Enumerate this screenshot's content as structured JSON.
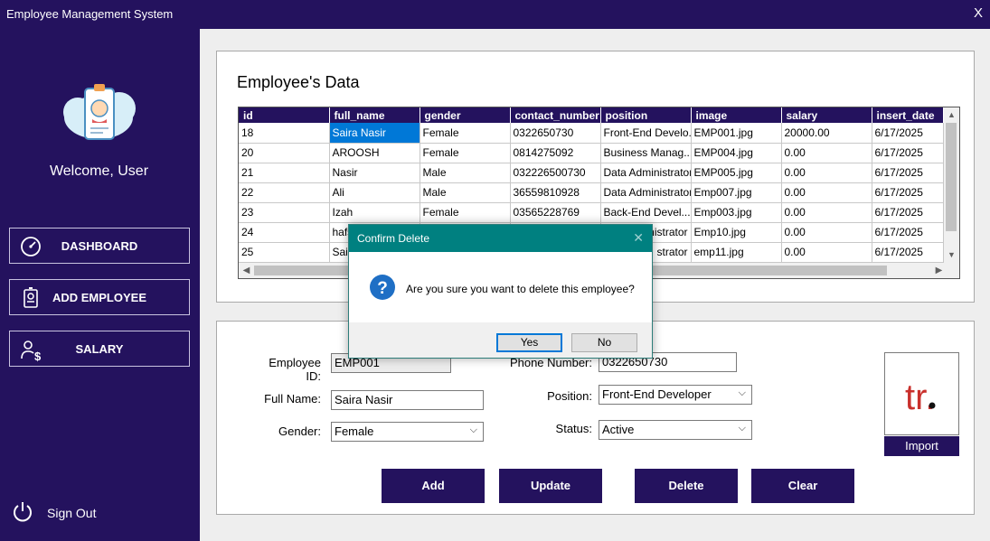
{
  "window": {
    "title": "Employee Management System",
    "close": "X"
  },
  "sidebar": {
    "welcome": "Welcome, User",
    "nav": {
      "dashboard": "DASHBOARD",
      "add_employee": "ADD EMPLOYEE",
      "salary": "SALARY"
    },
    "sign_out": "Sign Out"
  },
  "grid": {
    "title": "Employee's Data",
    "columns": [
      "id",
      "full_name",
      "gender",
      "contact_number",
      "position",
      "image",
      "salary",
      "insert_date"
    ],
    "rows": [
      [
        "18",
        "Saira Nasir",
        "Female",
        "0322650730",
        "Front-End Develo...",
        "EMP001.jpg",
        "20000.00",
        "6/17/2025"
      ],
      [
        "20",
        "AROOSH",
        "Female",
        "0814275092",
        "Business Manag...",
        "EMP004.jpg",
        "0.00",
        "6/17/2025"
      ],
      [
        "21",
        "Nasir",
        "Male",
        "032226500730",
        "Data Administrator",
        "EMP005.jpg",
        "0.00",
        "6/17/2025"
      ],
      [
        "22",
        "Ali",
        "Male",
        "36559810928",
        "Data Administrator",
        "Emp007.jpg",
        "0.00",
        "6/17/2025"
      ],
      [
        "23",
        "Izah",
        "Female",
        "03565228769",
        "Back-End Devel...",
        "Emp003.jpg",
        "0.00",
        "6/17/2025"
      ],
      [
        "24",
        "hafs",
        "",
        "",
        "dministrator",
        "Emp10.jpg",
        "0.00",
        "6/17/2025"
      ],
      [
        "25",
        "Sair",
        "",
        "",
        "strator",
        "emp11.jpg",
        "0.00",
        "6/17/2025"
      ]
    ]
  },
  "form": {
    "labels": {
      "employee_id": "Employee ID:",
      "full_name": "Full Name:",
      "gender": "Gender:",
      "phone": "Phone Number:",
      "position": "Position:",
      "status": "Status:"
    },
    "values": {
      "employee_id": "EMP001",
      "full_name": "Saira Nasir",
      "gender": "Female",
      "phone": "0322650730",
      "position": "Front-End Developer",
      "status": "Active"
    },
    "buttons": {
      "add": "Add",
      "update": "Update",
      "delete": "Delete",
      "clear": "Clear",
      "import": "Import"
    },
    "image_logo_text": "tr."
  },
  "dialog": {
    "title": "Confirm Delete",
    "message": "Are you sure you want to delete this employee?",
    "yes": "Yes",
    "no": "No"
  },
  "colors": {
    "primary": "#24125e",
    "dialog_title": "#008080",
    "selection": "#0078d7",
    "logo_red": "#c9302c"
  }
}
